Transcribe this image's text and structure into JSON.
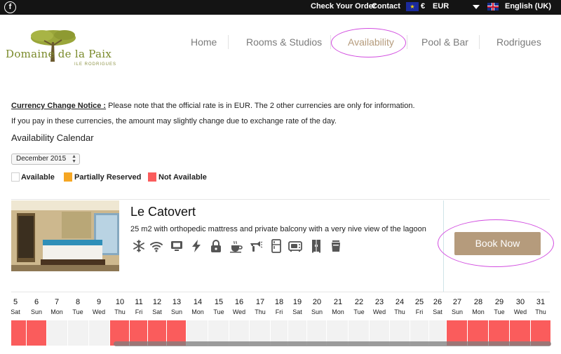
{
  "topbar": {
    "facebook_glyph": "f",
    "check_order": "Check Your Order",
    "contact": "Contact",
    "currency_symbol": "€",
    "currency_code": "EUR",
    "language": "English (UK)"
  },
  "logo": {
    "name": "Domaine de la Paix",
    "subtitle": "ILE RODRIGUES"
  },
  "nav": {
    "items": [
      "Home",
      "Rooms & Studios",
      "Availability",
      "Pool & Bar",
      "Rodrigues"
    ],
    "active": "Availability"
  },
  "notice": {
    "title": "Currency Change Notice :",
    "text": " Please note that the official rate is in EUR. The 2 other currencies are only for information.",
    "line2": "If you pay in these currencies, the amount may slightly change due to exchange rate of the day."
  },
  "calendar": {
    "section_title": "Availability Calendar",
    "month": "December 2015",
    "legend": [
      "Available",
      "Partially Reserved",
      "Not Available"
    ],
    "days": [
      {
        "d": "5",
        "w": "Sat",
        "s": "na"
      },
      {
        "d": "6",
        "w": "Sun",
        "s": "na"
      },
      {
        "d": "7",
        "w": "Mon",
        "s": "avail"
      },
      {
        "d": "8",
        "w": "Tue",
        "s": "avail"
      },
      {
        "d": "9",
        "w": "Wed",
        "s": "avail"
      },
      {
        "d": "10",
        "w": "Thu",
        "s": "na"
      },
      {
        "d": "11",
        "w": "Fri",
        "s": "na"
      },
      {
        "d": "12",
        "w": "Sat",
        "s": "na"
      },
      {
        "d": "13",
        "w": "Sun",
        "s": "na"
      },
      {
        "d": "14",
        "w": "Mon",
        "s": "avail"
      },
      {
        "d": "15",
        "w": "Tue",
        "s": "avail"
      },
      {
        "d": "16",
        "w": "Wed",
        "s": "avail"
      },
      {
        "d": "17",
        "w": "Thu",
        "s": "avail"
      },
      {
        "d": "18",
        "w": "Fri",
        "s": "avail"
      },
      {
        "d": "19",
        "w": "Sat",
        "s": "avail"
      },
      {
        "d": "20",
        "w": "Sun",
        "s": "avail"
      },
      {
        "d": "21",
        "w": "Mon",
        "s": "avail"
      },
      {
        "d": "22",
        "w": "Tue",
        "s": "avail"
      },
      {
        "d": "23",
        "w": "Wed",
        "s": "avail"
      },
      {
        "d": "24",
        "w": "Thu",
        "s": "avail"
      },
      {
        "d": "25",
        "w": "Fri",
        "s": "avail"
      },
      {
        "d": "26",
        "w": "Sat",
        "s": "avail"
      },
      {
        "d": "27",
        "w": "Sun",
        "s": "na"
      },
      {
        "d": "28",
        "w": "Mon",
        "s": "na"
      },
      {
        "d": "29",
        "w": "Tue",
        "s": "na"
      },
      {
        "d": "30",
        "w": "Wed",
        "s": "na"
      },
      {
        "d": "31",
        "w": "Thu",
        "s": "na"
      }
    ]
  },
  "room": {
    "title": "Le Catovert",
    "description": "25 m2 with orthopedic mattress and private balcony with a very nive view of the lagoon",
    "book_label": "Book Now",
    "amenities": [
      "snowflake-icon",
      "wifi-icon",
      "tv-icon",
      "electricity-icon",
      "lock-icon",
      "coffee-icon",
      "hairdryer-icon",
      "fridge-icon",
      "microwave-icon",
      "wardrobe-icon",
      "kettle-icon"
    ]
  },
  "colors": {
    "accent": "#b59b7c",
    "available": "#f2f2f2",
    "partial": "#f5a623",
    "not_available": "#fa5c5c",
    "highlight": "#d24de0"
  }
}
